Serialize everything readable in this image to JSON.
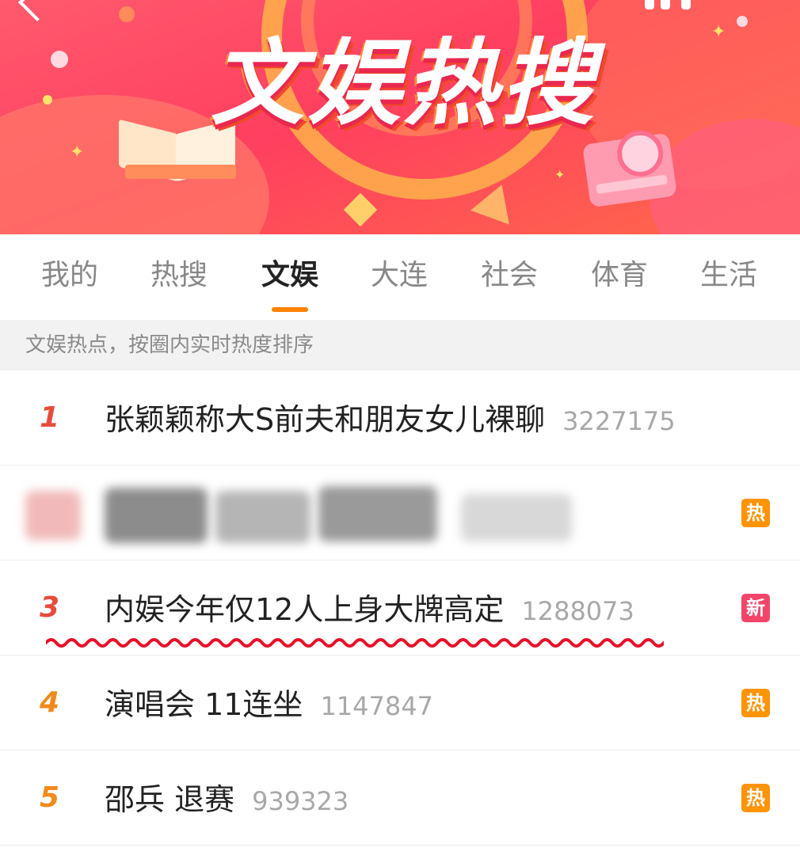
{
  "banner": {
    "title": "文娱热搜"
  },
  "tabs": [
    {
      "label": "我的"
    },
    {
      "label": "热搜"
    },
    {
      "label": "文娱"
    },
    {
      "label": "大连"
    },
    {
      "label": "社会"
    },
    {
      "label": "体育"
    },
    {
      "label": "生活"
    }
  ],
  "active_tab": "文娱",
  "subtitle": "文娱热点，按圈内实时热度排序",
  "list": [
    {
      "rank": "1",
      "topic": "张颖颖称大S前夫和朋友女儿裸聊",
      "count": "3227175",
      "badge": ""
    },
    {
      "rank": "",
      "topic": "",
      "count": "",
      "badge": "热",
      "redacted": true
    },
    {
      "rank": "3",
      "topic": "内娱今年仅12人上身大牌高定",
      "count": "1288073",
      "badge": "新",
      "underlined": true
    },
    {
      "rank": "4",
      "topic": "演唱会 11连坐",
      "count": "1147847",
      "badge": "热"
    },
    {
      "rank": "5",
      "topic": "邵兵 退赛",
      "count": "939323",
      "badge": "热"
    }
  ],
  "colors": {
    "accent_orange": "#ff8200",
    "rank_top": "#e64c3c",
    "rank_mid": "#f08a1c",
    "badge_hot": "#ff9406",
    "badge_new": "#f2456b",
    "squiggle_red": "#e8102a"
  },
  "icons": {
    "back": "back-chevron-icon",
    "share": "share-icon"
  }
}
